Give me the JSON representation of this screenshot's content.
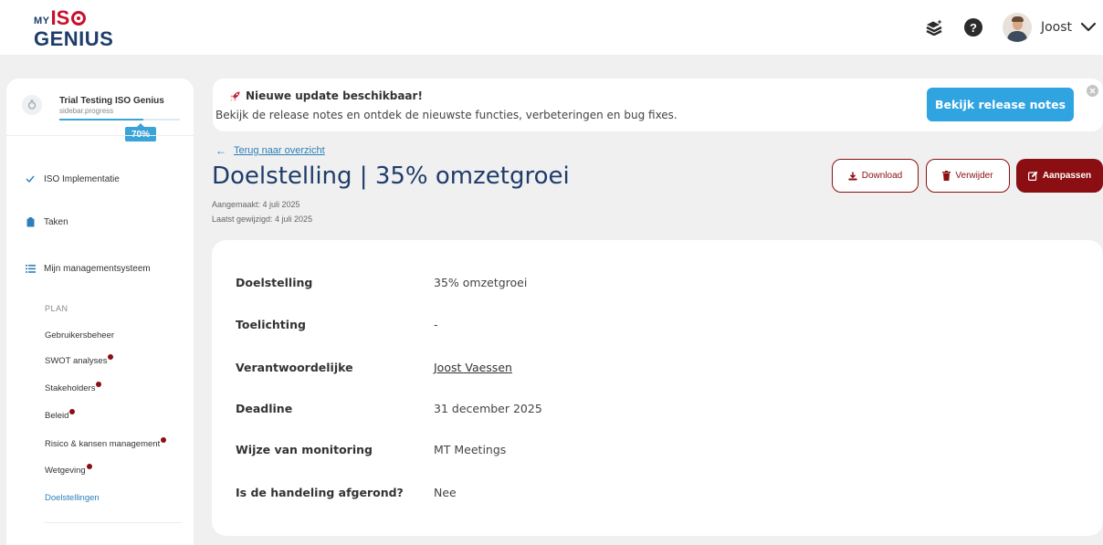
{
  "logo": {
    "my": "MY",
    "iso": "IS",
    "genius": "GENIUS"
  },
  "header": {
    "icons": [
      "layers-icon",
      "help-icon",
      "avatar",
      "chevron-down-icon"
    ],
    "user_name": "Joost"
  },
  "sidebar": {
    "org_name": "Trial Testing ISO Genius",
    "org_sub": "sidebar.progress",
    "progress_label": "70%",
    "progress_value": 0.7,
    "nav": [
      {
        "label": "ISO Implementatie",
        "icon": "check-icon"
      },
      {
        "label": "Taken",
        "icon": "clipboard-icon"
      },
      {
        "label": "Mijn managementsysteem",
        "icon": "list-icon"
      }
    ],
    "section_label": "PLAN",
    "sub_items": [
      {
        "label": "Gebruikersbeheer",
        "dot": false
      },
      {
        "label": "SWOT analyses",
        "dot": true
      },
      {
        "label": "Stakeholders",
        "dot": true
      },
      {
        "label": "Beleid",
        "dot": true
      },
      {
        "label": "Risico & kansen management",
        "dot": true
      },
      {
        "label": "Wetgeving",
        "dot": true
      },
      {
        "label": "Doelstellingen",
        "dot": false,
        "active": true
      }
    ]
  },
  "banner": {
    "title": "Nieuwe update beschikbaar!",
    "text": "Bekijk de release notes en ontdek de nieuwste functies, verbeteringen en bug fixes.",
    "button": "Bekijk release notes"
  },
  "page": {
    "back_link": "Terug naar overzicht",
    "title": "Doelstelling | 35% omzetgroei",
    "created": "Aangemaakt: 4 juli 2025",
    "modified": "Laatst gewijzigd: 4 juli 2025",
    "actions": {
      "download": "Download",
      "delete": "Verwijder",
      "edit": "Aanpassen"
    }
  },
  "details": [
    {
      "label": "Doelstelling",
      "value": "35% omzetgroei"
    },
    {
      "label": "Toelichting",
      "value": "-"
    },
    {
      "label": "Verantwoordelijke",
      "value": "Joost Vaessen"
    },
    {
      "label": "Deadline",
      "value": "31 december 2025"
    },
    {
      "label": "Wijze van monitoring",
      "value": "MT Meetings"
    },
    {
      "label": "Is de handeling afgerond?",
      "value": "Nee"
    }
  ],
  "colors": {
    "brand_red": "#8b0f12",
    "brand_blue": "#1f3c6b",
    "accent": "#2fa4e0",
    "dot": "#8b0f12"
  }
}
